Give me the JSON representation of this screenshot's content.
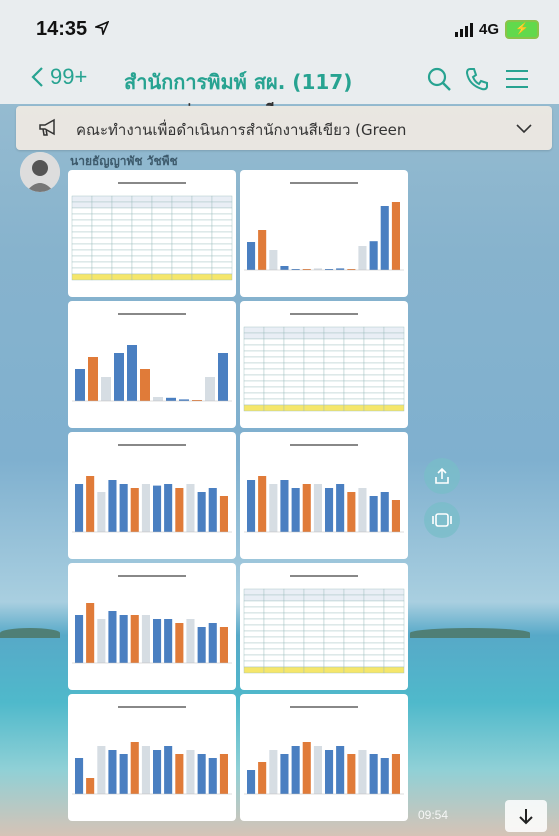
{
  "status_bar": {
    "time": "14:35",
    "network": "4G",
    "location_icon": "location-arrow-icon",
    "signal_icon": "signal-bars-icon",
    "battery_icon": "battery-charging-icon"
  },
  "header": {
    "back_label": "99+",
    "title": "สำนักการพิมพ์ สผ. (117)",
    "icons": [
      "search-icon",
      "phone-icon",
      "menu-icon"
    ],
    "accent": "#27a391"
  },
  "pinned": {
    "text": "คณะทำงานเพื่อดำเนินการสำนักงานสีเขียว (Green",
    "icon": "megaphone-icon"
  },
  "partial_previous_text": "ระบุยอดของแต่ละหมวด เตรียมตาดอบ",
  "message": {
    "sender": "นายธัญญาพัช วัชพืช",
    "time": "09:54",
    "tiles": [
      {
        "kind": "table"
      },
      {
        "kind": "chart",
        "values": [
          0.35,
          0.5,
          0.25,
          0.05,
          0.01,
          0.01,
          0.02,
          0.01,
          0.02,
          0.01,
          0.3,
          0.36,
          0.8,
          0.85
        ]
      },
      {
        "kind": "chart",
        "values": [
          0.4,
          0.55,
          0.3,
          0.6,
          0.7,
          0.4,
          0.05,
          0.04,
          0.02,
          0.01,
          0.3,
          0.6
        ]
      },
      {
        "kind": "table"
      },
      {
        "kind": "chart",
        "values": [
          0.6,
          0.7,
          0.5,
          0.65,
          0.6,
          0.55,
          0.6,
          0.58,
          0.6,
          0.55,
          0.6,
          0.5,
          0.55,
          0.45
        ]
      },
      {
        "kind": "chart",
        "values": [
          0.65,
          0.7,
          0.6,
          0.65,
          0.55,
          0.6,
          0.6,
          0.55,
          0.6,
          0.5,
          0.55,
          0.45,
          0.5,
          0.4
        ]
      },
      {
        "kind": "chart",
        "values": [
          0.6,
          0.75,
          0.55,
          0.65,
          0.6,
          0.6,
          0.6,
          0.55,
          0.55,
          0.5,
          0.55,
          0.45,
          0.5,
          0.45
        ]
      },
      {
        "kind": "table"
      },
      {
        "kind": "chart",
        "values": [
          0.45,
          0.2,
          0.6,
          0.55,
          0.5,
          0.65,
          0.6,
          0.55,
          0.6,
          0.5,
          0.55,
          0.5,
          0.45,
          0.5
        ]
      },
      {
        "kind": "chart",
        "values": [
          0.3,
          0.4,
          0.55,
          0.5,
          0.6,
          0.65,
          0.6,
          0.55,
          0.6,
          0.5,
          0.55,
          0.5,
          0.45,
          0.5
        ]
      }
    ]
  },
  "side_actions": [
    "share-icon",
    "album-icon"
  ],
  "scroll_down_icon": "arrow-down-icon"
}
